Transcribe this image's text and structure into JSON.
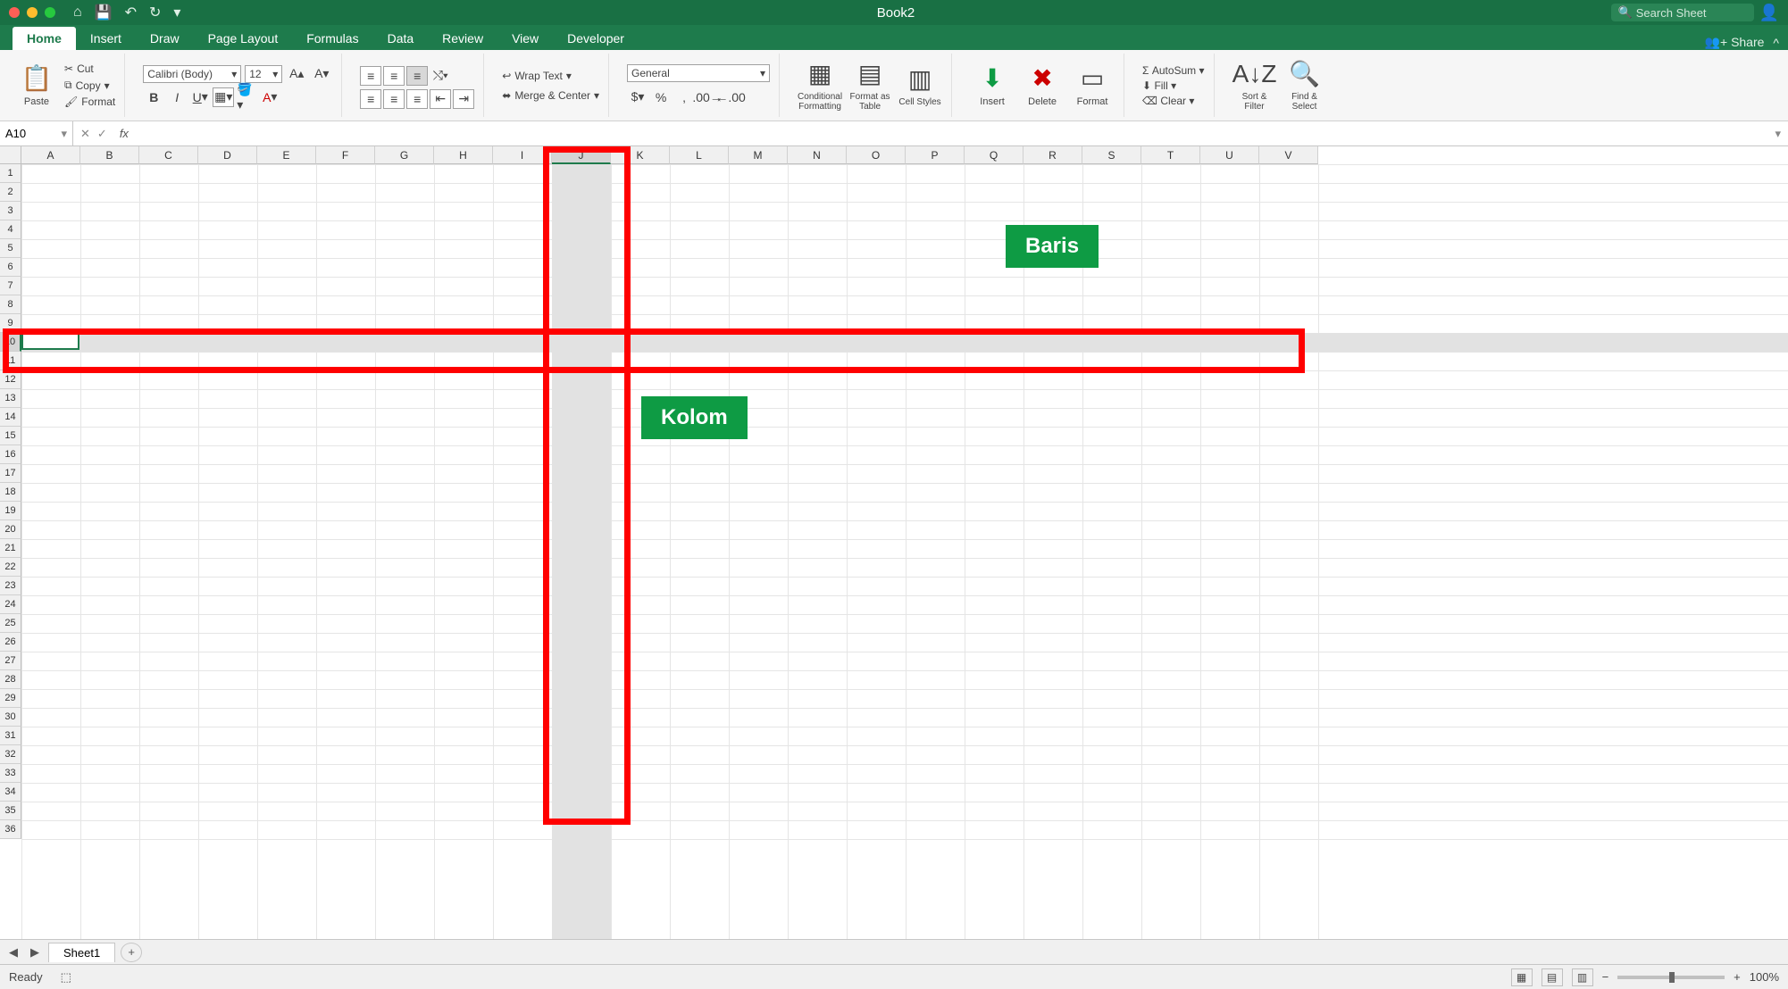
{
  "title": "Book2",
  "search_placeholder": "Search Sheet",
  "tabs": {
    "home": "Home",
    "insert": "Insert",
    "draw": "Draw",
    "page_layout": "Page Layout",
    "formulas": "Formulas",
    "data": "Data",
    "review": "Review",
    "view": "View",
    "developer": "Developer"
  },
  "share": "Share",
  "clipboard": {
    "paste": "Paste",
    "cut": "Cut",
    "copy": "Copy",
    "format": "Format"
  },
  "font": {
    "name": "Calibri (Body)",
    "size": "12"
  },
  "alignment": {
    "wrap": "Wrap Text",
    "merge": "Merge & Center"
  },
  "number_format": "General",
  "cond_fmt": "Conditional Formatting",
  "fmt_table": "Format as Table",
  "cell_styles": "Cell Styles",
  "cells": {
    "insert": "Insert",
    "delete": "Delete",
    "format": "Format"
  },
  "editing": {
    "autosum": "AutoSum",
    "fill": "Fill",
    "clear": "Clear"
  },
  "sort": "Sort & Filter",
  "find": "Find & Select",
  "namebox": "A10",
  "fx": "fx",
  "columns": [
    "A",
    "B",
    "C",
    "D",
    "E",
    "F",
    "G",
    "H",
    "I",
    "J",
    "K",
    "L",
    "M",
    "N",
    "O",
    "P",
    "Q",
    "R",
    "S",
    "T",
    "U",
    "V"
  ],
  "rows": [
    "1",
    "2",
    "3",
    "4",
    "5",
    "6",
    "7",
    "8",
    "9",
    "10",
    "11",
    "12",
    "13",
    "14",
    "15",
    "16",
    "17",
    "18",
    "19",
    "20",
    "21",
    "22",
    "23",
    "24",
    "25",
    "26",
    "27",
    "28",
    "29",
    "30",
    "31",
    "32",
    "33",
    "34",
    "35",
    "36"
  ],
  "highlighted_col_index": 9,
  "highlighted_row_index": 9,
  "callouts": {
    "baris": "Baris",
    "kolom": "Kolom"
  },
  "sheet_tab": "Sheet1",
  "status_text": "Ready",
  "zoom": "100%"
}
